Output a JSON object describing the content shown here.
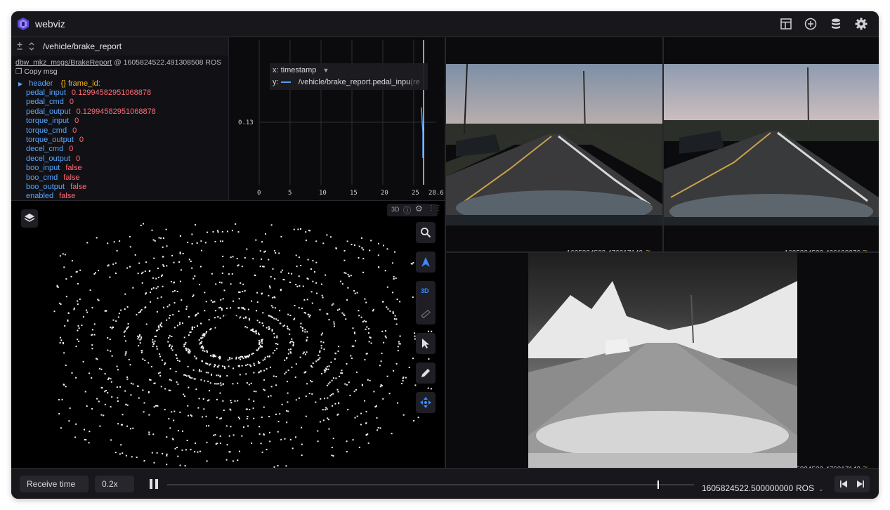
{
  "app": {
    "title": "webviz"
  },
  "raw_messages": {
    "topic": "/vehicle/brake_report",
    "datatype": "dbw_mkz_msgs/BrakeReport",
    "received_at": "@ 1605824522.491308508 ROS",
    "copy_label": "Copy msg",
    "header": {
      "key": "header",
      "value": "{} frame_id:"
    },
    "fields": [
      {
        "key": "pedal_input",
        "value": "0.12994582951068878"
      },
      {
        "key": "pedal_cmd",
        "value": "0"
      },
      {
        "key": "pedal_output",
        "value": "0.12994582951068878"
      },
      {
        "key": "torque_input",
        "value": "0"
      },
      {
        "key": "torque_cmd",
        "value": "0"
      },
      {
        "key": "torque_output",
        "value": "0"
      },
      {
        "key": "decel_cmd",
        "value": "0"
      },
      {
        "key": "decel_output",
        "value": "0"
      },
      {
        "key": "boo_input",
        "value": "false"
      },
      {
        "key": "boo_cmd",
        "value": "false"
      },
      {
        "key": "boo_output",
        "value": "false"
      },
      {
        "key": "enabled",
        "value": "false"
      }
    ]
  },
  "plot": {
    "x_label": "x:",
    "x_value": "timestamp",
    "y_label": "y:",
    "y_series": "/vehicle/brake_report.pedal_inpu",
    "y_series_suffix": "(re",
    "y_tick": "0.13",
    "x_ticks": [
      "0",
      "5",
      "10",
      "15",
      "20",
      "25",
      "28.6"
    ],
    "accent_color": "#5aa6ff"
  },
  "three_d": {
    "badge_3d": "3D",
    "toggle_3d": "3D",
    "toolbar": [
      "search-icon",
      "navigate-icon",
      "3d-toggle",
      "select-icon",
      "draw-icon",
      "move-icon"
    ]
  },
  "images": {
    "cam_left_ts": "1605824522.476017142",
    "cam_right_ts": "1605824522.426198276",
    "thermal_ts": "1605824522.476017142"
  },
  "playback": {
    "time_mode": "Receive time",
    "speed": "0.2x",
    "current_time": "1605824522.500000000",
    "time_format": "ROS",
    "progress": 0.93
  }
}
